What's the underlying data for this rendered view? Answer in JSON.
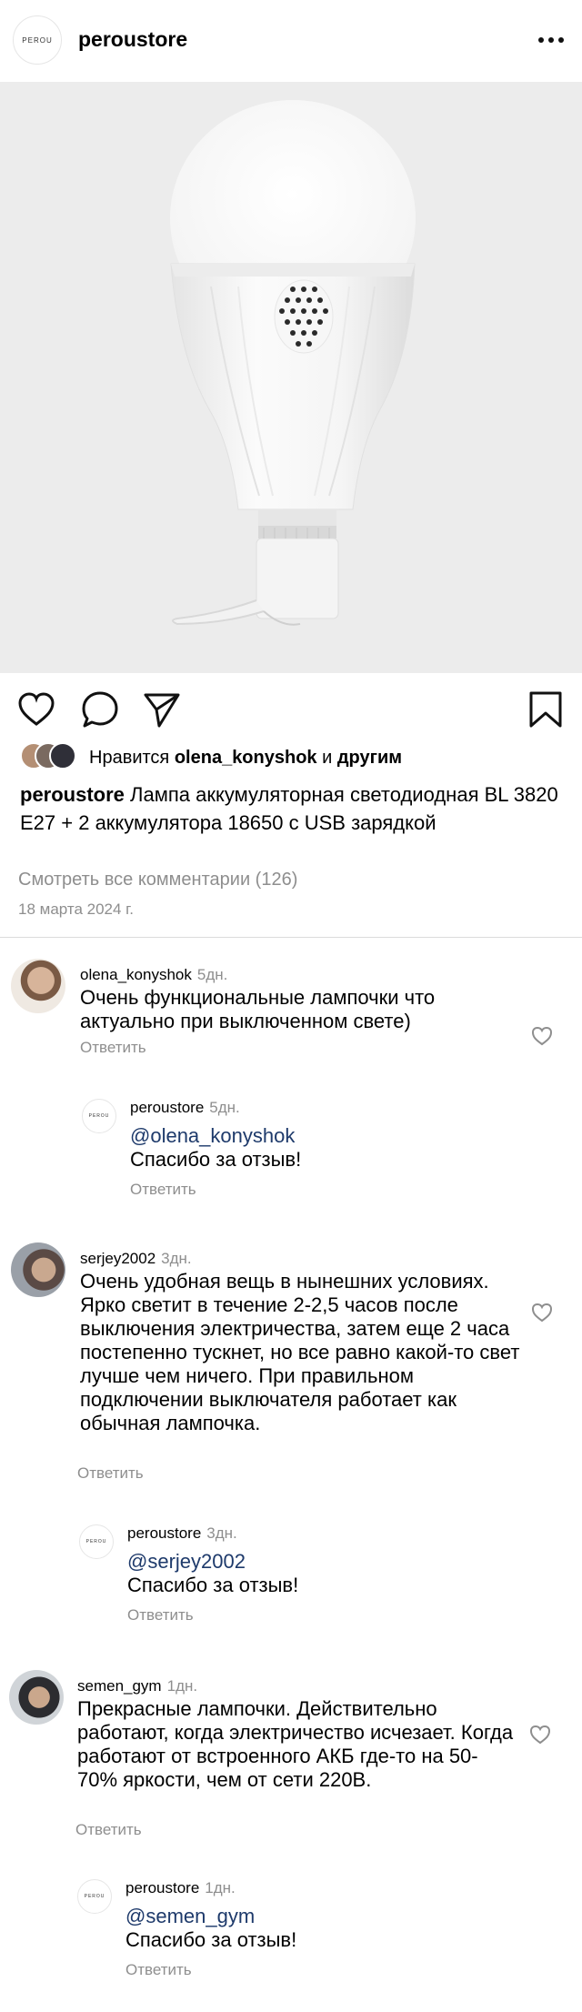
{
  "header": {
    "logo_text": "PEROU",
    "username": "peroustore"
  },
  "post": {
    "liked_by_prefix": "Нравится",
    "liked_by_user": "olena_konyshok",
    "liked_by_and": "и",
    "liked_by_others": "другим",
    "caption_user": "peroustore",
    "caption_text": "Лампа аккумуляторная светодиодная BL 3820 E27 + 2 аккумулятора 18650 с USB зарядкой",
    "view_all_comments": "Смотреть все комментарии (126)",
    "date": "18 марта 2024 г."
  },
  "comments": [
    {
      "user": "olena_konyshok",
      "ago": "5дн.",
      "text": "Очень функциональные лампочки что актуально при выключенном свете)",
      "reply_label": "Ответить",
      "reply": {
        "user": "peroustore",
        "ago": "5дн.",
        "mention": "@olena_konyshok",
        "text": "Спасибо за отзыв!",
        "reply_label": "Ответить"
      }
    },
    {
      "user": "serjey2002",
      "ago": "3дн.",
      "text": "Очень удобная вещь в нынешних условиях. Ярко светит в течение 2-2,5 часов после выключения электричества, затем еще 2 часа постепенно тускнет, но все равно какой-то свет лучше чем ничего. При правильном подключении выключателя работает как обычная лампочка.",
      "reply_label": "Ответить",
      "reply": {
        "user": "peroustore",
        "ago": "3дн.",
        "mention": "@serjey2002",
        "text": "Спасибо за отзыв!",
        "reply_label": "Ответить"
      }
    },
    {
      "user": "semen_gym",
      "ago": "1дн.",
      "text": "Прекрасные лампочки. Действительно работают, когда электричество исчезает. Когда работают от встроенного АКБ где-то на 50-70% яркости, чем от сети 220В.",
      "reply_label": "Ответить",
      "reply": {
        "user": "peroustore",
        "ago": "1дн.",
        "mention": "@semen_gym",
        "text": "Спасибо за отзыв!",
        "reply_label": "Ответить"
      }
    }
  ]
}
